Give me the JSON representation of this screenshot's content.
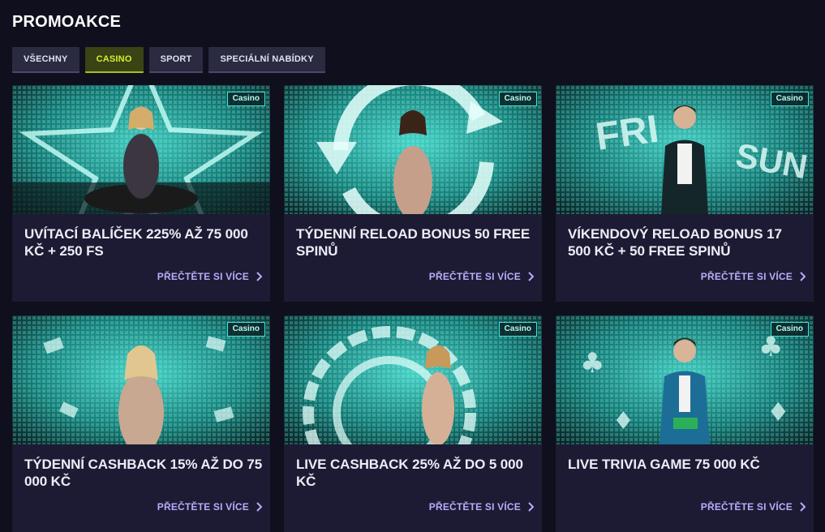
{
  "page": {
    "title": "PROMOAKCE"
  },
  "tabs": [
    {
      "label": "VŠECHNY",
      "active": false
    },
    {
      "label": "CASINO",
      "active": true
    },
    {
      "label": "SPORT",
      "active": false
    },
    {
      "label": "SPECIÁLNÍ NABÍDKY",
      "active": false
    }
  ],
  "colors": {
    "background": "#100f1d",
    "card": "#1d1b33",
    "accent": "#d6ef2c",
    "link": "#b5aefc",
    "badge_border": "#3fe6da"
  },
  "cards": [
    {
      "badge": "Casino",
      "title": "UVÍTACÍ BALÍČEK 225% AŽ 75 000 KČ + 250 FS",
      "cta": "PŘEČTĚTE SI VÍCE",
      "image": "woman-star-roulette"
    },
    {
      "badge": "Casino",
      "title": "TÝDENNÍ RELOAD BONUS 50 FREE SPINŮ",
      "cta": "PŘEČTĚTE SI VÍCE",
      "image": "woman-reload-arrows"
    },
    {
      "badge": "Casino",
      "title": "VÍKENDOVÝ RELOAD BONUS 17 500 KČ + 50 FREE SPINŮ",
      "cta": "PŘEČTĚTE SI VÍCE",
      "image": "man-fri-sun"
    },
    {
      "badge": "Casino",
      "title": "TÝDENNÍ CASHBACK 15% AŽ DO 75 000 KČ",
      "cta": "PŘEČTĚTE SI VÍCE",
      "image": "woman-cards-floating"
    },
    {
      "badge": "Casino",
      "title": "LIVE CASHBACK 25% AŽ DO 5 000 KČ",
      "cta": "PŘEČTĚTE SI VÍCE",
      "image": "woman-roulette-wheel"
    },
    {
      "badge": "Casino",
      "title": "LIVE TRIVIA GAME 75 000 KČ",
      "cta": "PŘEČTĚTE SI VÍCE",
      "image": "man-card-suits"
    }
  ]
}
